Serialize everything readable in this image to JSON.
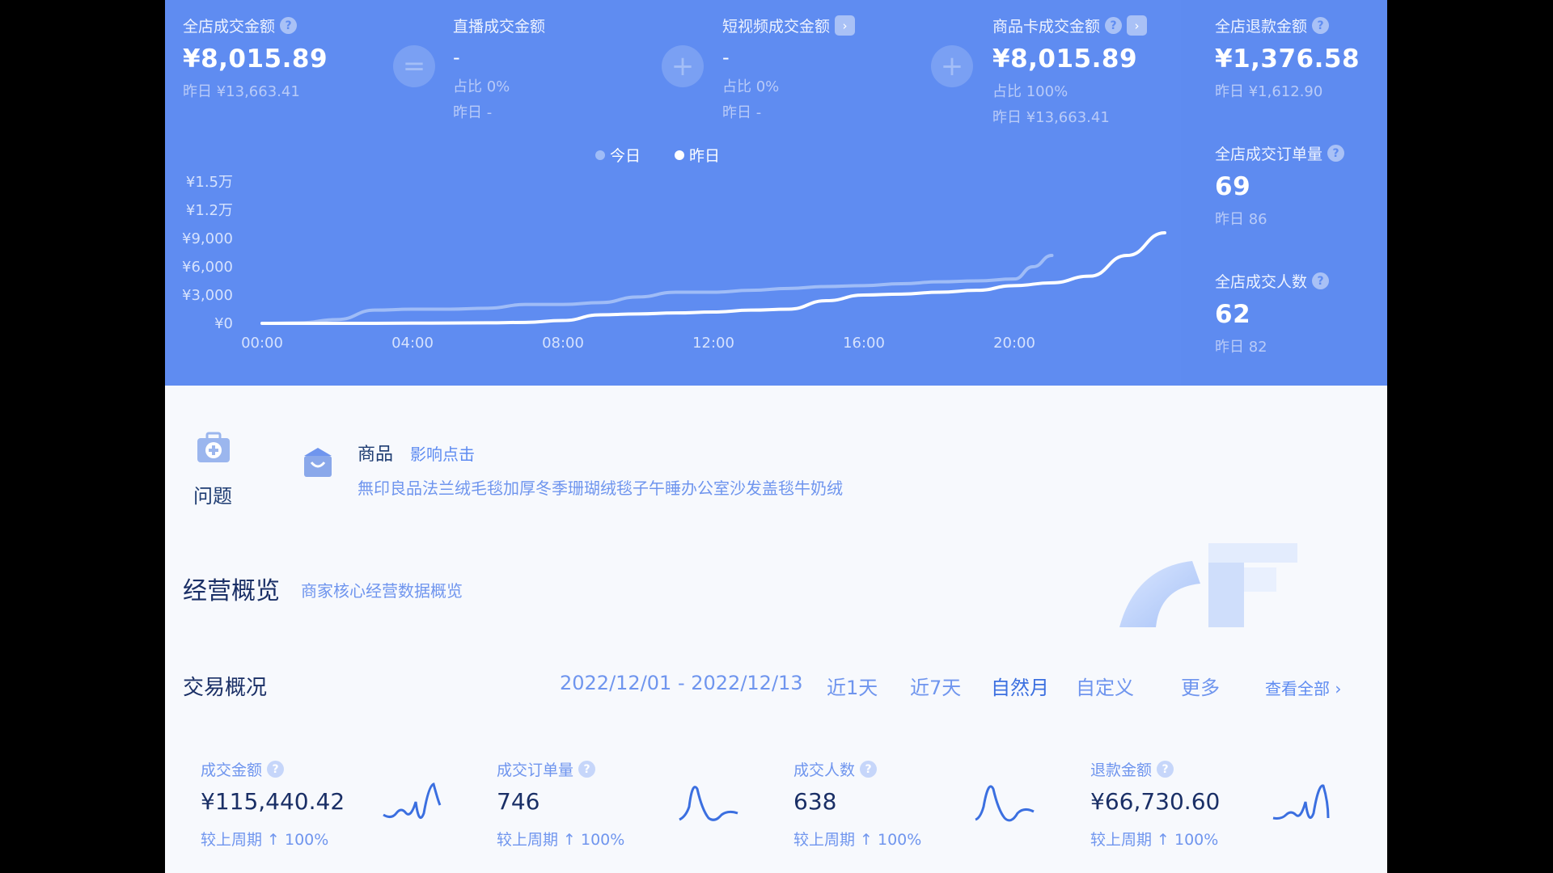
{
  "hero": {
    "metrics": [
      {
        "label": "全店成交金额",
        "value": "¥8,015.89",
        "sub": "昨日 ¥13,663.41",
        "sub2": "",
        "has_help": true,
        "has_arrow": false
      },
      {
        "label": "直播成交金额",
        "value": "-",
        "sub": "占比 0%",
        "sub2": "昨日 -",
        "has_help": false,
        "has_arrow": false
      },
      {
        "label": "短视频成交金额",
        "value": "-",
        "sub": "占比 0%",
        "sub2": "昨日 -",
        "has_help": false,
        "has_arrow": true
      },
      {
        "label": "商品卡成交金额",
        "value": "¥8,015.89",
        "sub": "占比 100%",
        "sub2": "昨日 ¥13,663.41",
        "has_help": true,
        "has_arrow": true
      },
      {
        "label": "全店退款金额",
        "value": "¥1,376.58",
        "sub": "昨日 ¥1,612.90",
        "sub2": "",
        "has_help": true,
        "has_arrow": false
      }
    ],
    "operators": [
      "=",
      "+",
      "+"
    ],
    "side_metrics": [
      {
        "label": "全店成交订单量",
        "value": "69",
        "sub": "昨日 86"
      },
      {
        "label": "全店成交人数",
        "value": "62",
        "sub": "昨日 82"
      }
    ]
  },
  "chart_data": {
    "type": "line",
    "yticks": [
      "¥1.5万",
      "¥1.2万",
      "¥9,000",
      "¥6,000",
      "¥3,000",
      "¥0"
    ],
    "xticks": [
      "00:00",
      "04:00",
      "08:00",
      "12:00",
      "16:00",
      "20:00"
    ],
    "ylim": [
      0,
      15000
    ],
    "series": [
      {
        "name": "今日",
        "color": "#9fbcf7",
        "x": [
          0,
          1,
          2,
          3,
          4,
          5,
          6,
          7,
          8,
          9,
          10,
          11,
          12,
          13,
          14,
          15,
          16,
          17,
          18,
          19,
          20,
          20.5,
          21
        ],
        "y": [
          0,
          50,
          400,
          1400,
          1500,
          1500,
          1600,
          2000,
          2000,
          2200,
          2800,
          3300,
          3300,
          3500,
          3700,
          3900,
          4000,
          4200,
          4400,
          4500,
          4700,
          6000,
          7200
        ]
      },
      {
        "name": "昨日",
        "color": "#ffffff",
        "x": [
          0,
          1,
          2,
          3,
          4,
          5,
          6,
          7,
          8,
          9,
          10,
          11,
          12,
          13,
          14,
          15,
          16,
          17,
          18,
          19,
          20,
          21,
          22,
          23,
          24
        ],
        "y": [
          0,
          0,
          0,
          0,
          20,
          30,
          50,
          100,
          300,
          900,
          1000,
          1100,
          1200,
          1400,
          1500,
          2400,
          3000,
          3100,
          3300,
          3500,
          4000,
          4300,
          5000,
          7200,
          9600
        ]
      }
    ]
  },
  "notice": {
    "tag": "问题",
    "product_title": "商品",
    "product_link": "影响点击",
    "product_desc": "無印良品法兰绒毛毯加厚冬季珊瑚绒毯子午睡办公室沙发盖毯牛奶绒"
  },
  "overview": {
    "title": "经营概览",
    "subtitle": "商家核心经营数据概览"
  },
  "trade": {
    "title": "交易概况",
    "date_range": "2022/12/01 - 2022/12/13",
    "periods": [
      "近1天",
      "近7天",
      "自然月",
      "自定义",
      "更多"
    ],
    "active_period": "自然月",
    "view_all": "查看全部 ›",
    "cards": [
      {
        "label": "成交金额",
        "value": "¥115,440.42",
        "compare": "较上周期 ↑ 100%"
      },
      {
        "label": "成交订单量",
        "value": "746",
        "compare": "较上周期 ↑ 100%"
      },
      {
        "label": "成交人数",
        "value": "638",
        "compare": "较上周期 ↑ 100%"
      },
      {
        "label": "退款金额",
        "value": "¥66,730.60",
        "compare": "较上周期 ↑ 100%"
      }
    ]
  },
  "colors": {
    "hero_bg": "#5f8cf1",
    "accent": "#3b6fe0",
    "text_dark": "#1a2f66",
    "text_soft": "#6f95ee"
  }
}
